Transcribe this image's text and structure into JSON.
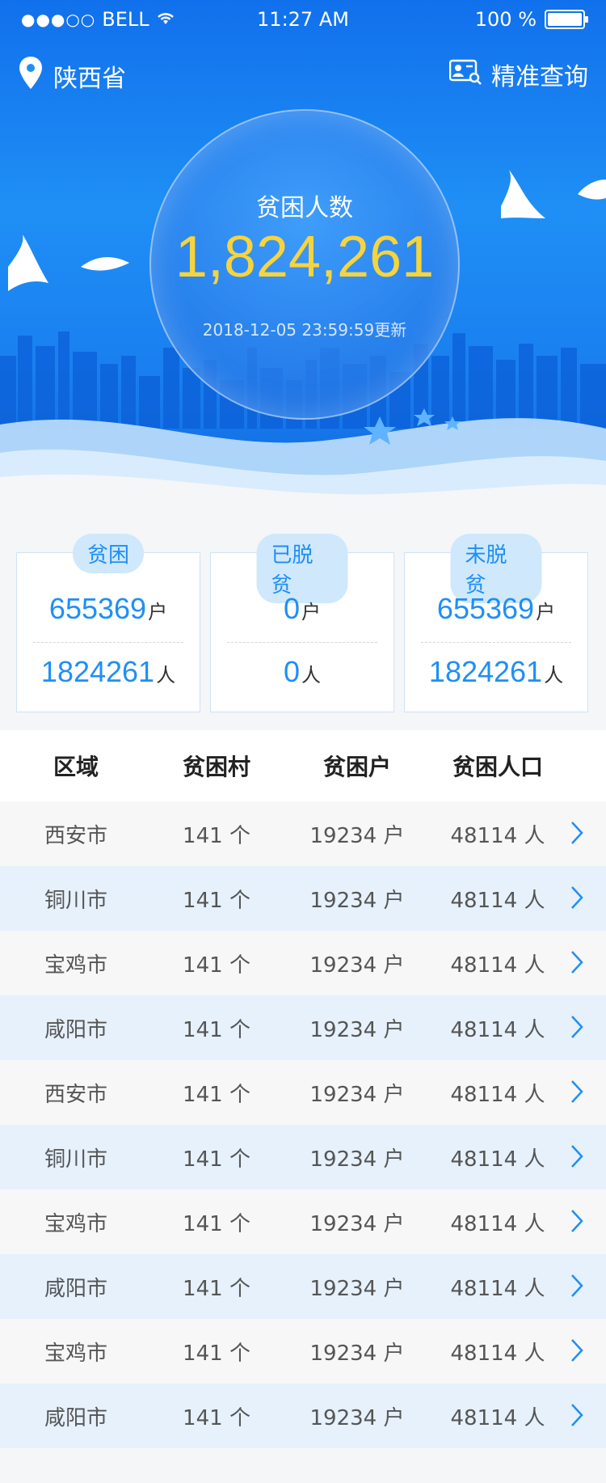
{
  "status_bar": {
    "signal": "●●●○○",
    "carrier": "BELL",
    "time": "11:27 AM",
    "battery_pct": "100 %"
  },
  "nav": {
    "location": "陕西省",
    "query_label": "精准查询"
  },
  "hero": {
    "label": "贫困人数",
    "count": "1,824,261",
    "updated": "2018-12-05 23:59:59更新"
  },
  "cards": [
    {
      "title": "贫困",
      "households": "655369",
      "households_unit": "户",
      "people": "1824261",
      "people_unit": "人"
    },
    {
      "title": "已脱贫",
      "households": "0",
      "households_unit": "户",
      "people": "0",
      "people_unit": "人"
    },
    {
      "title": "未脱贫",
      "households": "655369",
      "households_unit": "户",
      "people": "1824261",
      "people_unit": "人"
    }
  ],
  "table": {
    "headers": [
      "区域",
      "贫困村",
      "贫困户",
      "贫困人口"
    ],
    "rows": [
      {
        "region": "西安市",
        "villages": "141 个",
        "households": "19234 户",
        "population": "48114 人"
      },
      {
        "region": "铜川市",
        "villages": "141 个",
        "households": "19234 户",
        "population": "48114 人"
      },
      {
        "region": "宝鸡市",
        "villages": "141 个",
        "households": "19234 户",
        "population": "48114 人"
      },
      {
        "region": "咸阳市",
        "villages": "141 个",
        "households": "19234 户",
        "population": "48114 人"
      },
      {
        "region": "西安市",
        "villages": "141 个",
        "households": "19234 户",
        "population": "48114 人"
      },
      {
        "region": "铜川市",
        "villages": "141 个",
        "households": "19234 户",
        "population": "48114 人"
      },
      {
        "region": "宝鸡市",
        "villages": "141 个",
        "households": "19234 户",
        "population": "48114 人"
      },
      {
        "region": "咸阳市",
        "villages": "141 个",
        "households": "19234 户",
        "population": "48114 人"
      },
      {
        "region": "宝鸡市",
        "villages": "141 个",
        "households": "19234 户",
        "population": "48114 人"
      },
      {
        "region": "咸阳市",
        "villages": "141 个",
        "households": "19234 户",
        "population": "48114 人"
      }
    ]
  },
  "colors": {
    "primary": "#1f8ff5",
    "accent_yellow": "#f7d43c",
    "row_alt": "#e6f1fc"
  }
}
